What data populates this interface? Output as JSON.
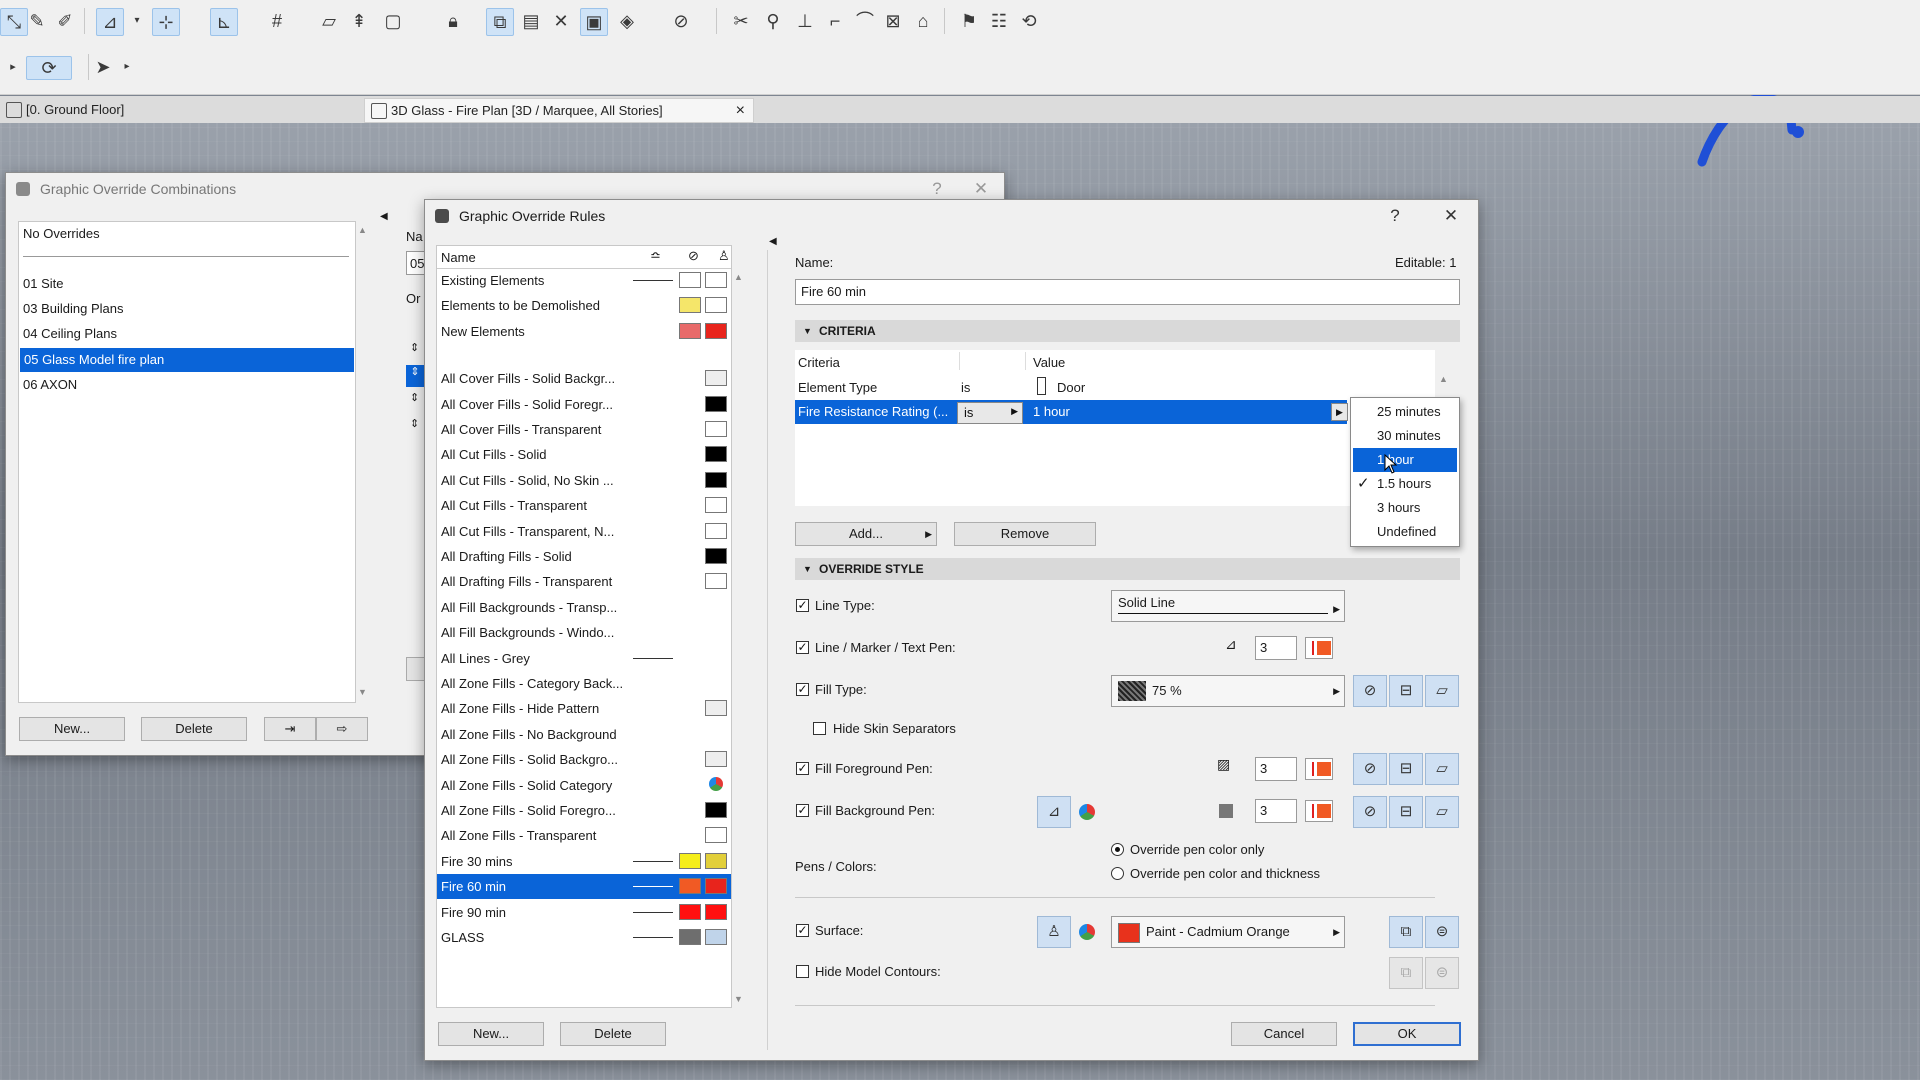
{
  "tabs": {
    "floor_tab": "[0. Ground Floor]",
    "glass_tab": "3D Glass - Fire Plan [3D / Marquee, All Stories]",
    "close": "×"
  },
  "combos": {
    "title": "Graphic Override Combinations",
    "help": "?",
    "close": "✕",
    "items": [
      {
        "label": "No Overrides"
      },
      {
        "label": "01 Site"
      },
      {
        "label": "03 Building Plans"
      },
      {
        "label": "04 Ceiling Plans"
      },
      {
        "label": "05 Glass Model fire plan"
      },
      {
        "label": "06 AXON"
      }
    ],
    "selected_index": 4,
    "new_label": "New...",
    "delete_label": "Delete",
    "side_name_label": "Na",
    "side_name_value": "05",
    "side_order_label": "Or"
  },
  "rules": {
    "title": "Graphic Override Rules",
    "help": "?",
    "close": "✕",
    "list_header": "Name",
    "items": [
      {
        "label": "Existing Elements",
        "line": true,
        "sw1": "#ffffff",
        "sw2": "#ffffff"
      },
      {
        "label": "Elements to be Demolished",
        "line": false,
        "sw1": "#f5e66a",
        "sw2": "#ffffff"
      },
      {
        "label": "New Elements",
        "line": false,
        "sw1": "#e86a6a",
        "sw2": "#e8241c"
      },
      {
        "label": "All Cover Fills - Solid Backgr...",
        "line": false,
        "sw1": "",
        "sw2": "#eeeeee"
      },
      {
        "label": "All Cover Fills - Solid Foregr...",
        "line": false,
        "sw1": "",
        "sw2": "#000000"
      },
      {
        "label": "All Cover Fills - Transparent",
        "line": false,
        "sw1": "",
        "sw2": "#ffffff"
      },
      {
        "label": "All Cut Fills - Solid",
        "line": false,
        "sw1": "",
        "sw2": "#000000"
      },
      {
        "label": "All Cut Fills - Solid, No Skin ...",
        "line": false,
        "sw1": "",
        "sw2": "#000000"
      },
      {
        "label": "All Cut Fills - Transparent",
        "line": false,
        "sw1": "",
        "sw2": "#ffffff"
      },
      {
        "label": "All Cut Fills - Transparent, N...",
        "line": false,
        "sw1": "",
        "sw2": "#ffffff"
      },
      {
        "label": "All Drafting Fills - Solid",
        "line": false,
        "sw1": "",
        "sw2": "#000000"
      },
      {
        "label": "All Drafting Fills - Transparent",
        "line": false,
        "sw1": "",
        "sw2": "#ffffff"
      },
      {
        "label": "All Fill Backgrounds - Transp...",
        "line": false,
        "sw1": "",
        "sw2": ""
      },
      {
        "label": "All Fill Backgrounds - Windo...",
        "line": false,
        "sw1": "",
        "sw2": ""
      },
      {
        "label": "All Lines - Grey",
        "line": true,
        "sw1": "",
        "sw2": ""
      },
      {
        "label": "All Zone Fills - Category Back...",
        "line": false,
        "sw1": "",
        "sw2": ""
      },
      {
        "label": "All Zone Fills - Hide Pattern",
        "line": false,
        "sw1": "",
        "sw2": "#eeeeee"
      },
      {
        "label": "All Zone Fills - No Background",
        "line": false,
        "sw1": "",
        "sw2": ""
      },
      {
        "label": "All Zone Fills - Solid Backgro...",
        "line": false,
        "sw1": "",
        "sw2": "#eeeeee"
      },
      {
        "label": "All Zone Fills - Solid Category",
        "line": false,
        "sw1": "",
        "sw2": "category"
      },
      {
        "label": "All Zone Fills - Solid Foregro...",
        "line": false,
        "sw1": "",
        "sw2": "#000000"
      },
      {
        "label": "All Zone Fills - Transparent",
        "line": false,
        "sw1": "",
        "sw2": "#ffffff"
      },
      {
        "label": "Fire 30 mins",
        "line": true,
        "sw1": "#f5ee1a",
        "sw2": "#e2cf3a"
      },
      {
        "label": "Fire 60 min",
        "line": true,
        "sw1": "#f15a24",
        "sw2": "#e8241c"
      },
      {
        "label": "Fire 90 min",
        "line": true,
        "sw1": "#ff1010",
        "sw2": "#ff1010"
      },
      {
        "label": "GLASS",
        "line": true,
        "sw1": "#6e6e6e",
        "sw2": "#c0d4ea"
      }
    ],
    "selected_index": 23,
    "new_label": "New...",
    "delete_label": "Delete"
  },
  "editor": {
    "name_label": "Name:",
    "editable_label": "Editable: 1",
    "name_value": "Fire 60 min",
    "criteria_title": "CRITERIA",
    "col_criteria": "Criteria",
    "col_value": "Value",
    "row1": {
      "criteria": "Element Type",
      "op": "is",
      "value": "Door"
    },
    "row2": {
      "criteria": "Fire Resistance Rating (...",
      "op": "is",
      "value": "1 hour"
    },
    "add_label": "Add...",
    "remove_label": "Remove",
    "dropdown": {
      "items": [
        "25 minutes",
        "30 minutes",
        "1 hour",
        "1.5 hours",
        "3 hours",
        "Undefined"
      ],
      "highlighted_index": 2,
      "checked_index": 3
    },
    "override_title": "OVERRIDE STYLE",
    "line_type_label": "Line Type:",
    "line_type_value": "Solid Line",
    "line_pen_label": "Line / Marker / Text Pen:",
    "line_pen_value": "3",
    "fill_type_label": "Fill Type:",
    "fill_type_value": "75 %",
    "hide_skin_label": "Hide Skin Separators",
    "fill_fg_label": "Fill Foreground Pen:",
    "fill_fg_value": "3",
    "fill_bg_label": "Fill Background Pen:",
    "fill_bg_value": "3",
    "pens_colors_label": "Pens / Colors:",
    "radio_color_only": "Override pen color only",
    "radio_color_thickness": "Override pen color and thickness",
    "surface_label": "Surface:",
    "surface_value": "Paint - Cadmium Orange",
    "surface_color": "#e8321c",
    "hide_contours_label": "Hide Model Contours:",
    "cancel_label": "Cancel",
    "ok_label": "OK"
  }
}
